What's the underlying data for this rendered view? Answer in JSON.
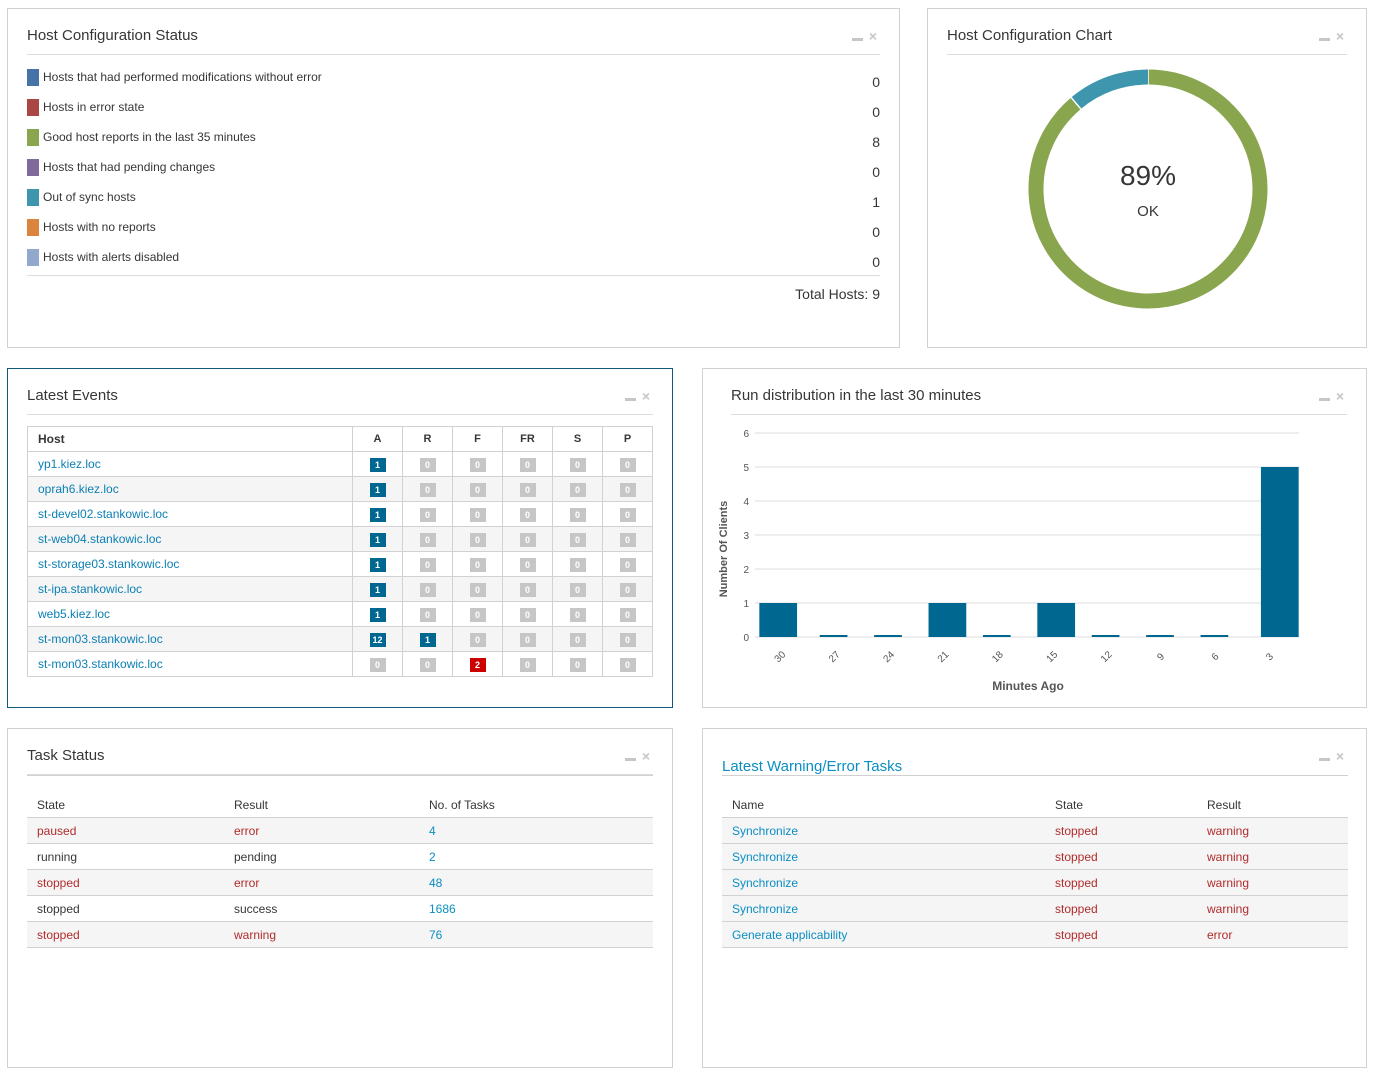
{
  "panels": {
    "host_config_status": {
      "title": "Host Configuration Status",
      "items": [
        {
          "label": "Hosts that had performed modifications without error",
          "value": "0",
          "color": "#4572a7"
        },
        {
          "label": "Hosts in error state",
          "value": "0",
          "color": "#aa4643"
        },
        {
          "label": "Good host reports in the last 35 minutes",
          "value": "8",
          "color": "#89a54e"
        },
        {
          "label": "Hosts that had pending changes",
          "value": "0",
          "color": "#80699b"
        },
        {
          "label": "Out of sync hosts",
          "value": "1",
          "color": "#3d96ae"
        },
        {
          "label": "Hosts with no reports",
          "value": "0",
          "color": "#db843d"
        },
        {
          "label": "Hosts with alerts disabled",
          "value": "0",
          "color": "#92a8cd"
        }
      ],
      "total_label": "Total Hosts: 9"
    },
    "host_config_chart": {
      "title": "Host Configuration Chart",
      "percent_label": "89%",
      "status_label": "OK"
    },
    "latest_events": {
      "title": "Latest Events",
      "columns": [
        "Host",
        "A",
        "R",
        "F",
        "FR",
        "S",
        "P"
      ],
      "rows": [
        {
          "host": "yp1.kiez.loc",
          "counts": [
            1,
            0,
            0,
            0,
            0,
            0
          ]
        },
        {
          "host": "oprah6.kiez.loc",
          "counts": [
            1,
            0,
            0,
            0,
            0,
            0
          ]
        },
        {
          "host": "st-devel02.stankowic.loc",
          "counts": [
            1,
            0,
            0,
            0,
            0,
            0
          ]
        },
        {
          "host": "st-web04.stankowic.loc",
          "counts": [
            1,
            0,
            0,
            0,
            0,
            0
          ]
        },
        {
          "host": "st-storage03.stankowic.loc",
          "counts": [
            1,
            0,
            0,
            0,
            0,
            0
          ]
        },
        {
          "host": "st-ipa.stankowic.loc",
          "counts": [
            1,
            0,
            0,
            0,
            0,
            0
          ]
        },
        {
          "host": "web5.kiez.loc",
          "counts": [
            1,
            0,
            0,
            0,
            0,
            0
          ]
        },
        {
          "host": "st-mon03.stankowic.loc",
          "counts": [
            12,
            1,
            0,
            0,
            0,
            0
          ]
        },
        {
          "host": "st-mon03.stankowic.loc",
          "counts": [
            0,
            0,
            2,
            0,
            0,
            0
          ]
        }
      ]
    },
    "run_distribution": {
      "title": "Run distribution in the last 30 minutes"
    },
    "task_status": {
      "title": "Task Status",
      "columns": [
        "State",
        "Result",
        "No. of Tasks"
      ],
      "rows": [
        {
          "state": "paused",
          "result": "error",
          "count": "4",
          "highlight": true
        },
        {
          "state": "running",
          "result": "pending",
          "count": "2",
          "highlight": false
        },
        {
          "state": "stopped",
          "result": "error",
          "count": "48",
          "highlight": true
        },
        {
          "state": "stopped",
          "result": "success",
          "count": "1686",
          "highlight": false
        },
        {
          "state": "stopped",
          "result": "warning",
          "count": "76",
          "highlight": true
        }
      ]
    },
    "warning_tasks": {
      "title": "Latest Warning/Error Tasks",
      "columns": [
        "Name",
        "State",
        "Result"
      ],
      "rows": [
        {
          "name": "Synchronize",
          "state": "stopped",
          "result": "warning"
        },
        {
          "name": "Synchronize",
          "state": "stopped",
          "result": "warning"
        },
        {
          "name": "Synchronize",
          "state": "stopped",
          "result": "warning"
        },
        {
          "name": "Synchronize",
          "state": "stopped",
          "result": "warning"
        },
        {
          "name": "Generate applicability",
          "state": "stopped",
          "result": "error"
        }
      ]
    }
  },
  "icons": {
    "minimize": "minimize-icon",
    "close": "close-icon"
  },
  "colors": {
    "accent_blue": "#006790",
    "link": "#0b8ec3",
    "error_red": "#b22b2b",
    "badge_red": "#cc0000",
    "badge_gray": "#c6c6c6"
  },
  "chart_data": [
    {
      "type": "pie",
      "title": "Host Configuration Chart",
      "center_label": "89%",
      "center_sublabel": "OK",
      "slices": [
        {
          "name": "Good host reports in the last 35 minutes",
          "value": 8,
          "color": "#89a54e"
        },
        {
          "name": "Out of sync hosts",
          "value": 1,
          "color": "#3d96ae"
        }
      ]
    },
    {
      "type": "bar",
      "title": "Run distribution in the last 30 minutes",
      "xlabel": "Minutes Ago",
      "ylabel": "Number Of Clients",
      "categories": [
        "30",
        "27",
        "24",
        "21",
        "18",
        "15",
        "12",
        "9",
        "6",
        "3"
      ],
      "values": [
        1,
        0,
        0,
        1,
        0,
        1,
        0,
        0,
        0,
        5
      ],
      "ylim": [
        0,
        6
      ],
      "yticks": [
        0,
        1,
        2,
        3,
        4,
        5,
        6
      ],
      "grid": true,
      "color": "#006790"
    }
  ]
}
